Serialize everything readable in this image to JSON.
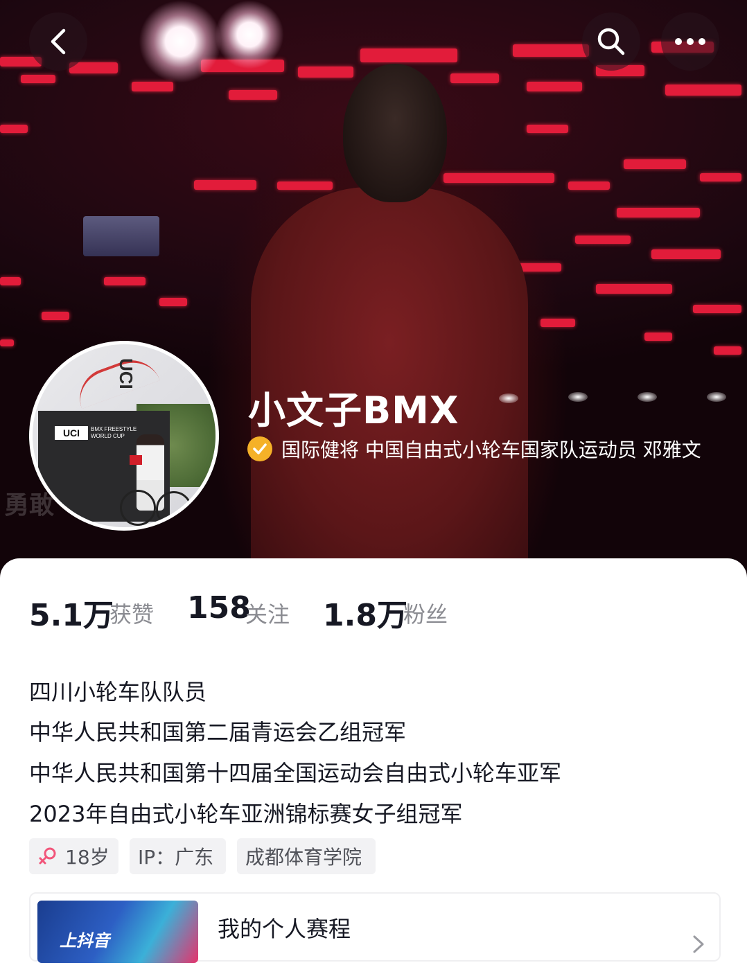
{
  "header": {
    "back_icon": "chevron-left-icon",
    "search_icon": "search-icon",
    "more_icon": "more-horizontal-icon"
  },
  "profile": {
    "nickname": "小文子BMX",
    "verification_icon": "verified-check-icon",
    "verification_color": "#f5b128",
    "verification_text": "国际健将 中国自由式小轮车国家队运动员 邓雅文",
    "avatar_text": "UCI",
    "avatar_subtext": "BMX FREESTYLE WORLD CUP",
    "hero_watermark": "勇敢"
  },
  "stats": [
    {
      "value": "5.1万",
      "label": "获赞"
    },
    {
      "value": "158",
      "label": "关注"
    },
    {
      "value": "1.8万",
      "label": "粉丝"
    }
  ],
  "bio": [
    "四川小轮车队队员",
    "中华人民共和国第二届青运会乙组冠军",
    "中华人民共和国第十四届全国运动会自由式小轮车亚军",
    "2023年自由式小轮车亚洲锦标赛女子组冠军"
  ],
  "tags": {
    "age": {
      "icon": "female-icon",
      "label": "18岁",
      "icon_color": "#f2557a"
    },
    "ip": "IP：广东",
    "school": "成都体育学院"
  },
  "schedule": {
    "thumb_text": "上抖音",
    "label": "我的个人赛程",
    "arrow_icon": "chevron-right-icon"
  }
}
